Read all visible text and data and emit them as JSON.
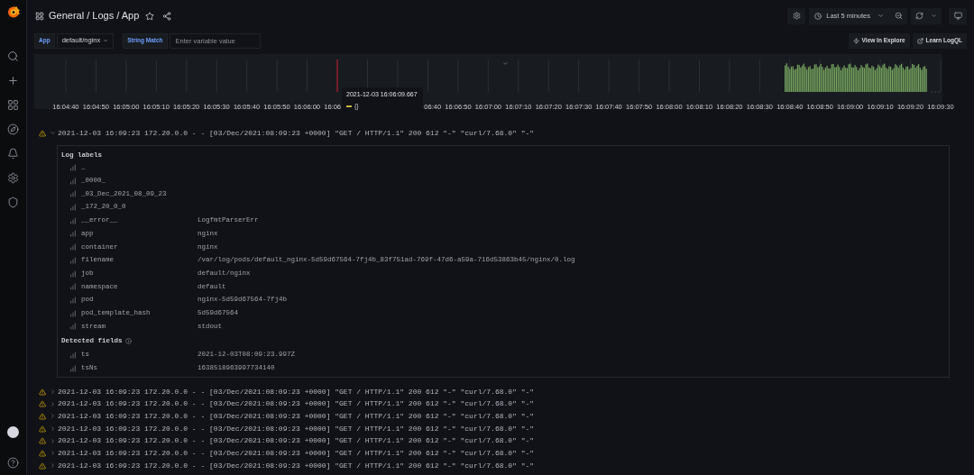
{
  "breadcrumb": "General / Logs / App",
  "time_range": "Last 5 minutes",
  "variables": [
    {
      "label": "App",
      "kind": "select",
      "value": "default/nginx"
    },
    {
      "label": "String Match",
      "kind": "text",
      "placeholder": "Enter variable value"
    }
  ],
  "actions": [
    {
      "label": "View In Explore",
      "kind": "explore"
    },
    {
      "label": "Learn LogQL",
      "kind": "external"
    }
  ],
  "chart": {
    "ticks_before": [
      "16:04:40",
      "16:04:50",
      "16:05:00",
      "16:05:10",
      "16:05:20",
      "16:05:30",
      "16:05:40",
      "16:05:50",
      "16:06:00",
      "16:06"
    ],
    "ticks_after": [
      "06:40",
      "16:06:50",
      "16:07:00",
      "16:07:10",
      "16:07:20",
      "16:07:30",
      "16:07:40",
      "16:07:50",
      "16:08:00",
      "16:08:10",
      "16:08:20",
      "16:08:30",
      "16:08:40",
      "16:08:50",
      "16:09:00",
      "16:09:10",
      "16:09:20",
      "16:09:30"
    ],
    "tooltip": {
      "time": "2021-12-03 16:06:09.667",
      "series": "{}",
      "color": "#c8b836"
    }
  },
  "logs": [
    {
      "text": "2021-12-03 16:09:23 172.20.0.0 - - [03/Dec/2021:08:09:23 +0000] \"GET / HTTP/1.1\" 200 612 \"-\" \"curl/7.68.0\" \"-\"",
      "expanded": true,
      "details": {
        "labels_title": "Log labels",
        "labels": [
          {
            "key": "_"
          },
          {
            "key": "_0000_"
          },
          {
            "key": "_03_Dec_2021_08_09_23"
          },
          {
            "key": "_172_20_0_0"
          },
          {
            "key": "__error__",
            "value": "LogfmtParserErr"
          },
          {
            "key": "app",
            "value": "nginx"
          },
          {
            "key": "container",
            "value": "nginx"
          },
          {
            "key": "filename",
            "value": "/var/log/pods/default_nginx-5d59d67564-7fj4b_83f751ad-769f-47d6-a59a-716d53863b45/nginx/0.log"
          },
          {
            "key": "job",
            "value": "default/nginx"
          },
          {
            "key": "namespace",
            "value": "default"
          },
          {
            "key": "pod",
            "value": "nginx-5d59d67564-7fj4b"
          },
          {
            "key": "pod_template_hash",
            "value": "5d59d67564"
          },
          {
            "key": "stream",
            "value": "stdout"
          }
        ],
        "fields_title": "Detected fields",
        "fields": [
          {
            "key": "ts",
            "value": "2021-12-03T08:09:23.997Z"
          },
          {
            "key": "tsNs",
            "value": "1638518963997734140"
          }
        ]
      }
    },
    {
      "text": "2021-12-03 16:09:23 172.20.0.0 - - [03/Dec/2021:08:09:23 +0000] \"GET / HTTP/1.1\" 200 612 \"-\" \"curl/7.68.0\" \"-\"",
      "expanded": false
    },
    {
      "text": "2021-12-03 16:09:23 172.20.0.0 - - [03/Dec/2021:08:09:23 +0000] \"GET / HTTP/1.1\" 200 612 \"-\" \"curl/7.68.0\" \"-\"",
      "expanded": false
    },
    {
      "text": "2021-12-03 16:09:23 172.20.0.0 - - [03/Dec/2021:08:09:23 +0000] \"GET / HTTP/1.1\" 200 612 \"-\" \"curl/7.68.0\" \"-\"",
      "expanded": false
    },
    {
      "text": "2021-12-03 16:09:23 172.20.0.0 - - [03/Dec/2021:08:09:23 +0000] \"GET / HTTP/1.1\" 200 612 \"-\" \"curl/7.68.0\" \"-\"",
      "expanded": false
    },
    {
      "text": "2021-12-03 16:09:23 172.20.0.0 - - [03/Dec/2021:08:09:23 +0000] \"GET / HTTP/1.1\" 200 612 \"-\" \"curl/7.68.0\" \"-\"",
      "expanded": false
    },
    {
      "text": "2021-12-03 16:09:23 172.20.0.0 - - [03/Dec/2021:08:09:23 +0000] \"GET / HTTP/1.1\" 200 612 \"-\" \"curl/7.68.0\" \"-\"",
      "expanded": false
    },
    {
      "text": "2021-12-03 16:09:23 172.20.0.0 - - [03/Dec/2021:08:09:23 +0000] \"GET / HTTP/1.1\" 200 612 \"-\" \"curl/7.68.0\" \"-\"",
      "expanded": false
    }
  ]
}
